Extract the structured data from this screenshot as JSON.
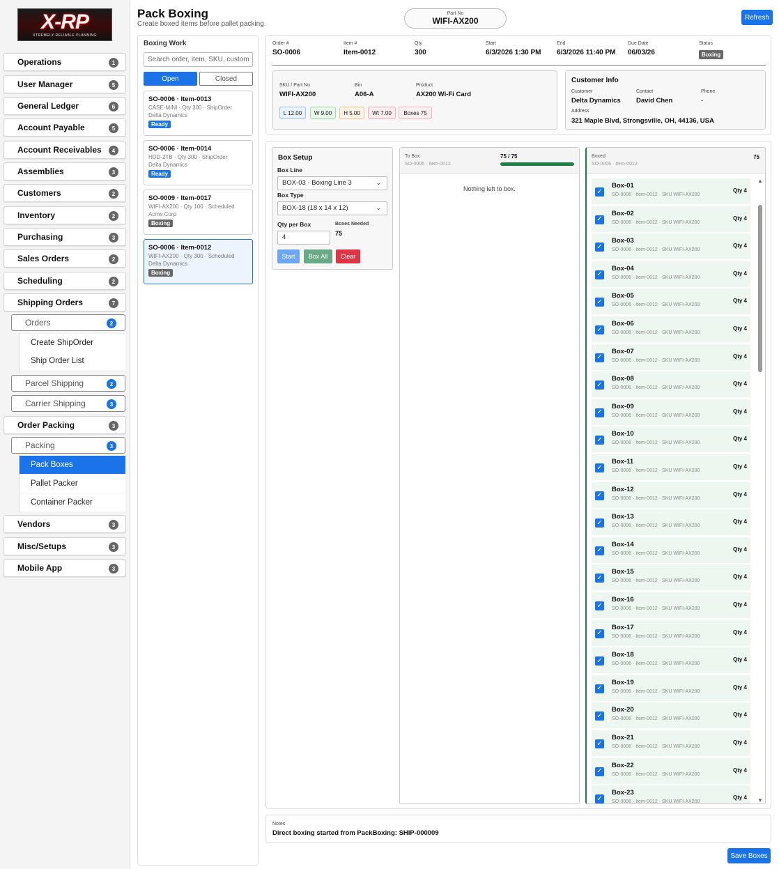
{
  "logo": {
    "title": "X-RP",
    "tagline": "XTREMELY RELIABLE PLANNING"
  },
  "sidebar": {
    "items": [
      {
        "label": "Operations",
        "count": "1"
      },
      {
        "label": "User Manager",
        "count": "5"
      },
      {
        "label": "General Ledger",
        "count": "6"
      },
      {
        "label": "Account Payable",
        "count": "5"
      },
      {
        "label": "Account Receivables",
        "count": "4"
      },
      {
        "label": "Assemblies",
        "count": "3"
      },
      {
        "label": "Customers",
        "count": "2"
      },
      {
        "label": "Inventory",
        "count": "2"
      },
      {
        "label": "Purchasing",
        "count": "3"
      },
      {
        "label": "Sales Orders",
        "count": "2"
      },
      {
        "label": "Scheduling",
        "count": "2"
      },
      {
        "label": "Shipping Orders",
        "count": "7"
      },
      {
        "label": "Order Packing",
        "count": "3"
      },
      {
        "label": "Vendors",
        "count": "3"
      },
      {
        "label": "Misc/Setups",
        "count": "3"
      },
      {
        "label": "Mobile App",
        "count": "3"
      }
    ],
    "shipping_sub": [
      {
        "label": "Orders",
        "count": "2"
      },
      {
        "label": "Parcel Shipping",
        "count": "2"
      },
      {
        "label": "Carrier Shipping",
        "count": "3"
      }
    ],
    "orders_leaves": [
      "Create ShipOrder",
      "Ship Order List"
    ],
    "packing_sub": {
      "label": "Packing",
      "count": "3"
    },
    "packing_leaves": [
      "Pack Boxes",
      "Pallet Packer",
      "Container Packer"
    ]
  },
  "header": {
    "title": "Pack Boxing",
    "subtitle": "Create boxed items before pallet packing.",
    "partno_label": "Part No",
    "partno_value": "WIFI-AX200",
    "refresh_label": "Refresh"
  },
  "boxing_work": {
    "title": "Boxing Work",
    "search_placeholder": "Search order, item, SKU, customer...",
    "tab_open": "Open",
    "tab_closed": "Closed",
    "cards": [
      {
        "title": "SO-0006 · Item-0013",
        "line1": "CASE-MINI · Qty 300 · ShipOrder",
        "line2": "Delta Dynamics",
        "status": "Ready"
      },
      {
        "title": "SO-0006 · Item-0014",
        "line1": "HDD-2TB · Qty 300 · ShipOrder",
        "line2": "Delta Dynamics",
        "status": "Ready"
      },
      {
        "title": "SO-0009 · Item-0017",
        "line1": "WIFI-AX200 · Qty 100 · Scheduled",
        "line2": "Acme Corp",
        "status": "Boxing"
      },
      {
        "title": "SO-0006 · Item-0012",
        "line1": "WIFI-AX200 · Qty 300 · Scheduled",
        "line2": "Delta Dynamics",
        "status": "Boxing"
      }
    ]
  },
  "order": {
    "order_label": "Order #",
    "order": "SO-0006",
    "item_label": "Item #",
    "item": "Item-0012",
    "qty_label": "Qty",
    "qty": "300",
    "start_label": "Start",
    "start": "6/3/2026 1:30 PM",
    "end_label": "End",
    "end": "6/3/2026 11:40 PM",
    "due_label": "Due Date",
    "due": "06/03/26",
    "status_label": "Status",
    "status": "Boxing",
    "sku_label": "SKU / Part No",
    "sku": "WIFI-AX200",
    "bin_label": "Bin",
    "bin": "A06-A",
    "product_label": "Product",
    "product": "AX200 Wi-Fi Card",
    "dims": {
      "l": "L 12.00",
      "w": "W 9.00",
      "h": "H 5.00",
      "wt": "Wt 7.00",
      "boxes": "Boxes 75"
    }
  },
  "customer": {
    "title": "Customer Info",
    "customer_label": "Customer",
    "customer": "Delta Dynamics",
    "contact_label": "Contact",
    "contact": "David Chen",
    "phone_label": "Phone",
    "phone": "-",
    "address_label": "Address",
    "address": "321 Maple Blvd, Strongsville, OH, 44136, USA"
  },
  "box_setup": {
    "title": "Box Setup",
    "box_line_label": "Box Line",
    "box_line": "BOX-03 - Boxing Line 3",
    "box_type_label": "Box Type",
    "box_type": "BOX-18 (18 x 14 x 12)",
    "qty_per_box_label": "Qty per Box",
    "qty_per_box": "4",
    "boxes_needed_label": "Boxes Needed",
    "boxes_needed": "75",
    "start": "Start",
    "box_all": "Box All",
    "clear": "Clear"
  },
  "to_box": {
    "title": "To Box",
    "sub": "SO-0006 · Item-0012",
    "progress_text": "75 / 75",
    "progress": 1.0,
    "empty": "Nothing left to box."
  },
  "boxed": {
    "title": "Boxed",
    "sub": "SO-0006 · Item-0012",
    "count": "75",
    "rows": [
      {
        "name": "Box-01",
        "sub": "SO-0006 · Item-0012 · SKU WIFI-AX200",
        "qty": "Qty 4"
      },
      {
        "name": "Box-02",
        "sub": "SO-0006 · Item-0012 · SKU WIFI-AX200",
        "qty": "Qty 4"
      },
      {
        "name": "Box-03",
        "sub": "SO-0006 · Item-0012 · SKU WIFI-AX200",
        "qty": "Qty 4"
      },
      {
        "name": "Box-04",
        "sub": "SO-0006 · Item-0012 · SKU WIFI-AX200",
        "qty": "Qty 4"
      },
      {
        "name": "Box-05",
        "sub": "SO-0006 · Item-0012 · SKU WIFI-AX200",
        "qty": "Qty 4"
      },
      {
        "name": "Box-06",
        "sub": "SO-0006 · Item-0012 · SKU WIFI-AX200",
        "qty": "Qty 4"
      },
      {
        "name": "Box-07",
        "sub": "SO-0006 · Item-0012 · SKU WIFI-AX200",
        "qty": "Qty 4"
      },
      {
        "name": "Box-08",
        "sub": "SO-0006 · Item-0012 · SKU WIFI-AX200",
        "qty": "Qty 4"
      },
      {
        "name": "Box-09",
        "sub": "SO-0006 · Item-0012 · SKU WIFI-AX200",
        "qty": "Qty 4"
      },
      {
        "name": "Box-10",
        "sub": "SO-0006 · Item-0012 · SKU WIFI-AX200",
        "qty": "Qty 4"
      },
      {
        "name": "Box-11",
        "sub": "SO-0006 · Item-0012 · SKU WIFI-AX200",
        "qty": "Qty 4"
      },
      {
        "name": "Box-12",
        "sub": "SO-0006 · Item-0012 · SKU WIFI-AX200",
        "qty": "Qty 4"
      },
      {
        "name": "Box-13",
        "sub": "SO-0006 · Item-0012 · SKU WIFI-AX200",
        "qty": "Qty 4"
      },
      {
        "name": "Box-14",
        "sub": "SO-0006 · Item-0012 · SKU WIFI-AX200",
        "qty": "Qty 4"
      },
      {
        "name": "Box-15",
        "sub": "SO-0006 · Item-0012 · SKU WIFI-AX200",
        "qty": "Qty 4"
      },
      {
        "name": "Box-16",
        "sub": "SO-0006 · Item-0012 · SKU WIFI-AX200",
        "qty": "Qty 4"
      },
      {
        "name": "Box-17",
        "sub": "SO-0006 · Item-0012 · SKU WIFI-AX200",
        "qty": "Qty 4"
      },
      {
        "name": "Box-18",
        "sub": "SO-0006 · Item-0012 · SKU WIFI-AX200",
        "qty": "Qty 4"
      },
      {
        "name": "Box-19",
        "sub": "SO-0006 · Item-0012 · SKU WIFI-AX200",
        "qty": "Qty 4"
      },
      {
        "name": "Box-20",
        "sub": "SO-0006 · Item-0012 · SKU WIFI-AX200",
        "qty": "Qty 4"
      },
      {
        "name": "Box-21",
        "sub": "SO-0006 · Item-0012 · SKU WIFI-AX200",
        "qty": "Qty 4"
      },
      {
        "name": "Box-22",
        "sub": "SO-0006 · Item-0012 · SKU WIFI-AX200",
        "qty": "Qty 4"
      },
      {
        "name": "Box-23",
        "sub": "SO-0006 · Item-0012 · SKU WIFI-AX200",
        "qty": "Qty 4"
      }
    ]
  },
  "notes": {
    "label": "Notes",
    "text": "Direct boxing started from PackBoxing: SHIP-000009"
  },
  "save_label": "Save Boxes",
  "colors": {
    "accent": "#1a73e8",
    "success": "#1e7e45",
    "danger": "#dc3545",
    "muted_badge": "#666666"
  }
}
